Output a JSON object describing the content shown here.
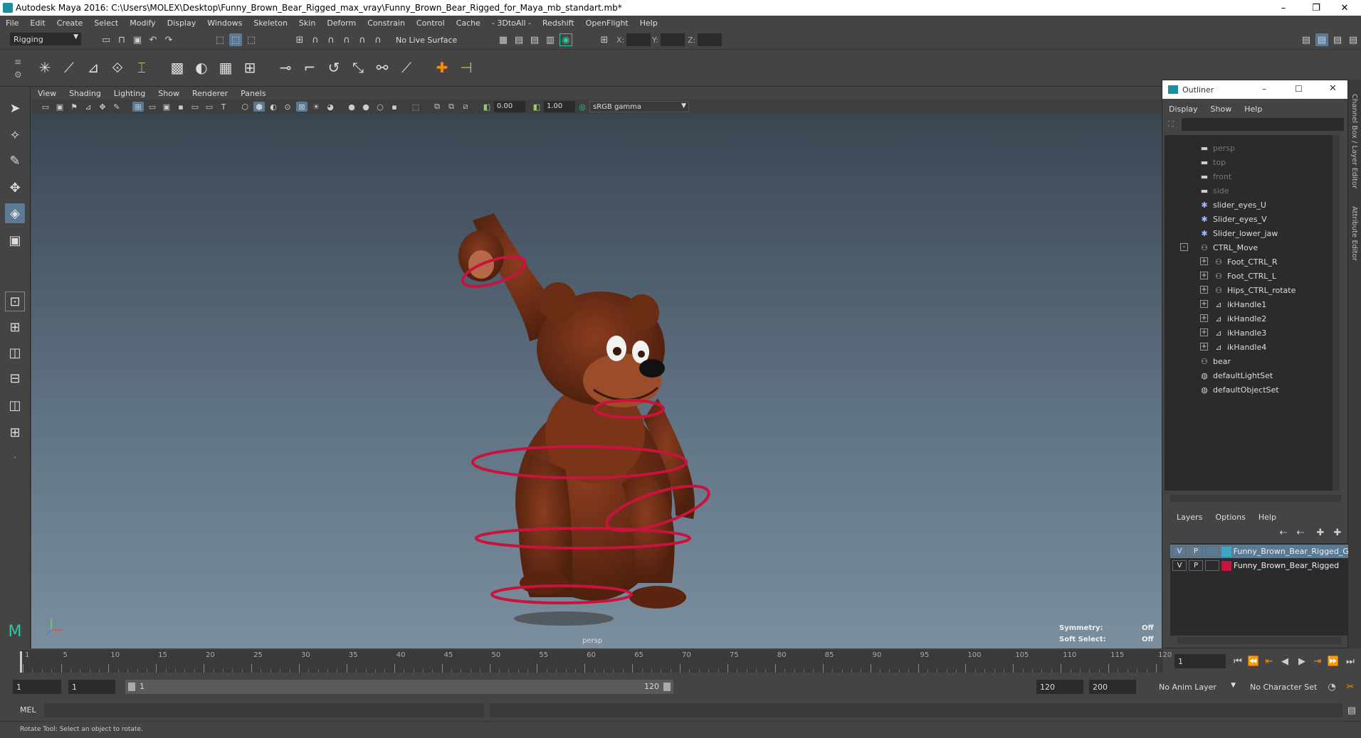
{
  "window": {
    "title": "Autodesk Maya 2016: C:\\Users\\MOLEX\\Desktop\\Funny_Brown_Bear_Rigged_max_vray\\Funny_Brown_Bear_Rigged_for_Maya_mb_standart.mb*"
  },
  "menu": [
    "File",
    "Edit",
    "Create",
    "Select",
    "Modify",
    "Display",
    "Windows",
    "Skeleton",
    "Skin",
    "Deform",
    "Constrain",
    "Control",
    "Cache",
    "- 3DtoAll -",
    "Redshift",
    "OpenFlight",
    "Help"
  ],
  "status": {
    "mode": "Rigging",
    "live_surface": "No Live Surface",
    "x_label": "X:",
    "y_label": "Y:",
    "z_label": "Z:"
  },
  "panel": {
    "menu": [
      "View",
      "Shading",
      "Lighting",
      "Show",
      "Renderer",
      "Panels"
    ],
    "exposure": "0.00",
    "gamma": "1.00",
    "colorspace": "sRGB gamma"
  },
  "viewport": {
    "camera": "persp",
    "symmetry_label": "Symmetry:",
    "symmetry_value": "Off",
    "softsel_label": "Soft Select:",
    "softsel_value": "Off"
  },
  "outliner": {
    "title": "Outliner",
    "menu": [
      "Display",
      "Show",
      "Help"
    ],
    "items": [
      {
        "label": "persp",
        "dim": true,
        "indent": 0,
        "icon": "camera-icon"
      },
      {
        "label": "top",
        "dim": true,
        "indent": 0,
        "icon": "camera-icon"
      },
      {
        "label": "front",
        "dim": true,
        "indent": 0,
        "icon": "camera-icon"
      },
      {
        "label": "side",
        "dim": true,
        "indent": 0,
        "icon": "camera-icon"
      },
      {
        "label": "slider_eyes_U",
        "dim": false,
        "indent": 0,
        "icon": "star-icon"
      },
      {
        "label": "Slider_eyes_V",
        "dim": false,
        "indent": 0,
        "icon": "star-icon"
      },
      {
        "label": "Slider_lower_jaw",
        "dim": false,
        "indent": 0,
        "icon": "star-icon"
      },
      {
        "label": "CTRL_Move",
        "dim": false,
        "indent": 0,
        "icon": "transform-icon",
        "expand": "-"
      },
      {
        "label": "Foot_CTRL_R",
        "dim": false,
        "indent": 1,
        "icon": "transform-icon",
        "expand": "+"
      },
      {
        "label": "Foot_CTRL_L",
        "dim": false,
        "indent": 1,
        "icon": "transform-icon",
        "expand": "+"
      },
      {
        "label": "Hips_CTRL_rotate",
        "dim": false,
        "indent": 1,
        "icon": "transform-icon",
        "expand": "+"
      },
      {
        "label": "ikHandle1",
        "dim": false,
        "indent": 1,
        "icon": "ikhandle-icon",
        "expand": "+"
      },
      {
        "label": "ikHandle2",
        "dim": false,
        "indent": 1,
        "icon": "ikhandle-icon",
        "expand": "+"
      },
      {
        "label": "ikHandle3",
        "dim": false,
        "indent": 1,
        "icon": "ikhandle-icon",
        "expand": "+"
      },
      {
        "label": "ikHandle4",
        "dim": false,
        "indent": 1,
        "icon": "ikhandle-icon",
        "expand": "+"
      },
      {
        "label": "bear",
        "dim": false,
        "indent": 0,
        "icon": "transform-icon"
      },
      {
        "label": "defaultLightSet",
        "dim": false,
        "indent": 0,
        "icon": "set-icon"
      },
      {
        "label": "defaultObjectSet",
        "dim": false,
        "indent": 0,
        "icon": "set-icon"
      }
    ]
  },
  "layers": {
    "menu": [
      "Layers",
      "Options",
      "Help"
    ],
    "rows": [
      {
        "v": "V",
        "p": "P",
        "name": "Funny_Brown_Bear_Rigged_G",
        "color": "#3aa6c8",
        "selected": true
      },
      {
        "v": "V",
        "p": "P",
        "name": "Funny_Brown_Bear_Rigged",
        "color": "#c8143c",
        "selected": false
      }
    ]
  },
  "side_tabs": [
    "Channel Box / Layer Editor",
    "Attribute Editor"
  ],
  "timeline": {
    "ticks": [
      "1",
      "5",
      "10",
      "15",
      "20",
      "25",
      "30",
      "35",
      "40",
      "45",
      "50",
      "55",
      "60",
      "65",
      "70",
      "75",
      "80",
      "85",
      "90",
      "95",
      "100",
      "105",
      "110",
      "115",
      "120"
    ],
    "current_frame": "1"
  },
  "range": {
    "start": "1",
    "playback_start": "1",
    "slider_start": "1",
    "slider_end": "120",
    "playback_end": "120",
    "end": "200",
    "anim_layer": "No Anim Layer",
    "char_set": "No Character Set"
  },
  "cmd": {
    "mel": "MEL"
  },
  "help": {
    "text": "Rotate Tool: Select an object to rotate."
  },
  "colors": {
    "accent": "#5a7a96",
    "ring": "#c8143c",
    "bear": "#6b2c14"
  }
}
